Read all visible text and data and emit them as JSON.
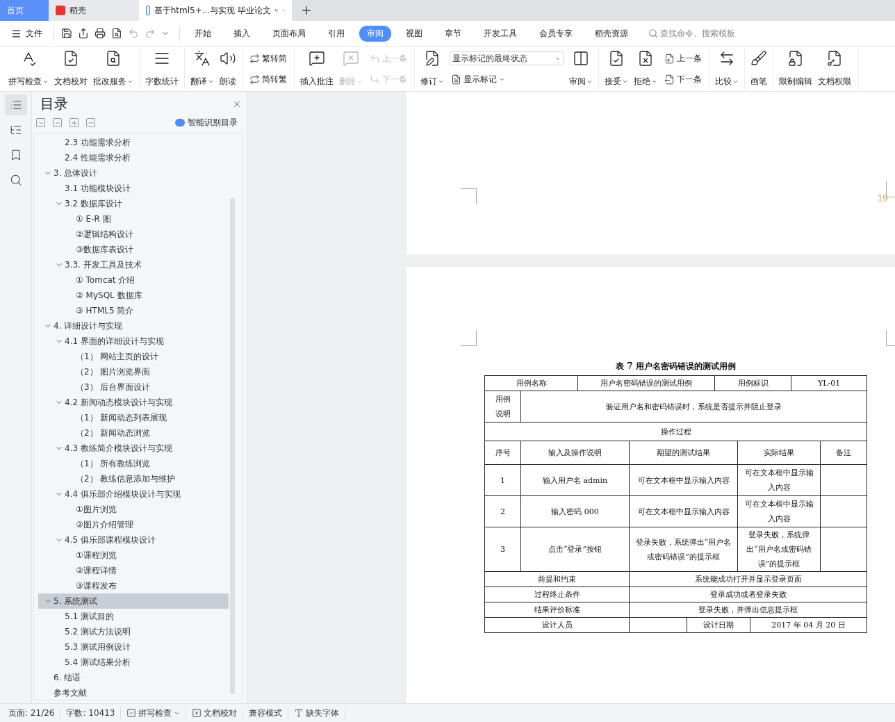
{
  "tabs": [
    {
      "kind": "home",
      "label": "首页",
      "selected": false
    },
    {
      "kind": "app",
      "label": "稻壳",
      "selected": false
    },
    {
      "kind": "doc",
      "label": "基于html5+...与实现 毕业论文",
      "selected": true
    }
  ],
  "menu": {
    "file": "文件",
    "tabs": [
      {
        "label": "开始",
        "selected": false
      },
      {
        "label": "插入",
        "selected": false
      },
      {
        "label": "页面布局",
        "selected": false
      },
      {
        "label": "引用",
        "selected": false
      },
      {
        "label": "审阅",
        "selected": true
      },
      {
        "label": "视图",
        "selected": false
      },
      {
        "label": "章节",
        "selected": false
      },
      {
        "label": "开发工具",
        "selected": false
      },
      {
        "label": "会员专享",
        "selected": false
      },
      {
        "label": "稻壳资源",
        "selected": false
      }
    ],
    "search": {
      "placeholder": "查找命令、搜索模板"
    }
  },
  "ribbon": [
    {
      "items": [
        {
          "kind": "big",
          "label": "拼写检查",
          "dropdown": true,
          "disabled": false
        },
        {
          "kind": "big",
          "label": "文档校对",
          "dropdown": false,
          "disabled": false
        },
        {
          "kind": "big",
          "label": "批改服务",
          "dropdown": true,
          "disabled": false
        }
      ]
    },
    {
      "items": [
        {
          "kind": "big",
          "label": "字数统计",
          "dropdown": false,
          "disabled": false
        }
      ]
    },
    {
      "items": [
        {
          "kind": "big",
          "label": "翻译",
          "dropdown": true,
          "disabled": false
        },
        {
          "kind": "big",
          "label": "朗读",
          "dropdown": false,
          "disabled": false
        }
      ]
    },
    {
      "items": [
        {
          "kind": "pair",
          "rows": [
            {
              "label": "繁转简",
              "disabled": false
            },
            {
              "label": "简转繁",
              "disabled": false
            }
          ]
        }
      ]
    },
    {
      "items": [
        {
          "kind": "big",
          "label": "插入批注",
          "dropdown": false,
          "disabled": false
        },
        {
          "kind": "big",
          "label": "删除",
          "dropdown": true,
          "disabled": true
        },
        {
          "kind": "pair",
          "rows": [
            {
              "label": "上一条",
              "disabled": true
            },
            {
              "label": "下一条",
              "disabled": true
            }
          ]
        }
      ]
    },
    {
      "items": [
        {
          "kind": "big",
          "label": "修订",
          "dropdown": true,
          "disabled": false
        },
        {
          "kind": "select",
          "value": "显示标记的最终状态",
          "row": {
            "label": "显示标记",
            "dropdown": true
          }
        },
        {
          "kind": "big",
          "label": "审阅",
          "dropdown": true,
          "disabled": false
        }
      ]
    },
    {
      "items": [
        {
          "kind": "big",
          "label": "接受",
          "dropdown": true,
          "disabled": false
        },
        {
          "kind": "big",
          "label": "拒绝",
          "dropdown": true,
          "disabled": false
        },
        {
          "kind": "pair",
          "rows": [
            {
              "label": "上一条",
              "disabled": false
            },
            {
              "label": "下一条",
              "disabled": false
            }
          ]
        }
      ]
    },
    {
      "items": [
        {
          "kind": "big",
          "label": "比较",
          "dropdown": true,
          "disabled": false
        }
      ]
    },
    {
      "items": [
        {
          "kind": "big",
          "label": "画笔",
          "dropdown": false,
          "disabled": false
        }
      ]
    },
    {
      "items": [
        {
          "kind": "big",
          "label": "限制编辑",
          "dropdown": false,
          "disabled": false
        },
        {
          "kind": "big",
          "label": "文档权限",
          "dropdown": false,
          "disabled": false
        }
      ]
    }
  ],
  "sidebar": {
    "title": "目录",
    "smart_button": "智能识别目录",
    "toc": {
      "scrolled_section_items": [
        {
          "label": "2.3 功能需求分析",
          "selected": false
        },
        {
          "label": "2.4 性能需求分析",
          "selected": false
        }
      ],
      "items": [
        {
          "label": "3.  总体设计",
          "selected": false,
          "expanded": true,
          "children": [
            {
              "label": "3.1 功能模块设计",
              "selected": false
            },
            {
              "label": "3.2 数据库设计",
              "selected": false,
              "expanded": true,
              "children": [
                {
                  "label": "① E-R 图",
                  "selected": false
                },
                {
                  "label": "②逻辑结构设计",
                  "selected": false
                },
                {
                  "label": "③数据库表设计",
                  "selected": false
                }
              ]
            },
            {
              "label": "3.3.  开发工具及技术",
              "selected": false,
              "expanded": true,
              "children": [
                {
                  "label": "① Tomcat 介绍",
                  "selected": false
                },
                {
                  "label": "② MySQL 数据库",
                  "selected": false
                },
                {
                  "label": "③ HTML5 简介",
                  "selected": false
                }
              ]
            }
          ]
        },
        {
          "label": "4.  详细设计与实现",
          "selected": false,
          "expanded": true,
          "children": [
            {
              "label": "4.1 界面的详细设计与实现",
              "selected": false,
              "expanded": true,
              "children": [
                {
                  "label": "（1） 网站主页的设计",
                  "selected": false
                },
                {
                  "label": "（2） 图片浏览界面",
                  "selected": false
                },
                {
                  "label": "（3） 后台界面设计",
                  "selected": false
                }
              ]
            },
            {
              "label": "4.2 新闻动态模块设计与实现",
              "selected": false,
              "expanded": true,
              "children": [
                {
                  "label": "（1） 新闻动态列表展现",
                  "selected": false
                },
                {
                  "label": "（2） 新闻动态浏览",
                  "selected": false
                }
              ]
            },
            {
              "label": "4.3 教练简介模块设计与实现",
              "selected": false,
              "expanded": true,
              "children": [
                {
                  "label": "（1） 所有教练浏览",
                  "selected": false
                },
                {
                  "label": "（2） 教练信息添加与维护",
                  "selected": false
                }
              ]
            },
            {
              "label": "4.4 俱乐部介绍模块设计与实现",
              "selected": false,
              "expanded": true,
              "children": [
                {
                  "label": "①图片浏览",
                  "selected": false
                },
                {
                  "label": "②图片介绍管理",
                  "selected": false
                }
              ]
            },
            {
              "label": "4.5 俱乐部课程模块设计",
              "selected": false,
              "expanded": true,
              "children": [
                {
                  "label": "①课程浏览",
                  "selected": false
                },
                {
                  "label": "②课程详情",
                  "selected": false
                },
                {
                  "label": "③课程发布",
                  "selected": false
                }
              ]
            }
          ]
        },
        {
          "label": "5.  系统测试",
          "selected": true,
          "expanded": true,
          "children": [
            {
              "label": "5.1 测试目的",
              "selected": false
            },
            {
              "label": "5.2 测试方法说明",
              "selected": false
            },
            {
              "label": "5.3 测试用例设计",
              "selected": false
            },
            {
              "label": "5.4 测试结果分析",
              "selected": false
            }
          ]
        },
        {
          "label": "6.  结语",
          "selected": false
        },
        {
          "label": "参考文献",
          "selected": false
        }
      ]
    }
  },
  "document": {
    "page_number": "19",
    "table": {
      "caption": "表 7  用户名密码错误的测试用例",
      "rows": [
        {
          "kind": "info",
          "cells": [
            {
              "text": "用例名称",
              "colspan": 2
            },
            {
              "text": "用户名密码错误的测试用例",
              "colspan": 3
            },
            {
              "text": "用例标识",
              "colspan": 3
            },
            {
              "text": "YL-01",
              "colspan": 2
            }
          ]
        },
        {
          "kind": "description",
          "cells": [
            {
              "text": "用例说明"
            },
            {
              "text": "验证用户名和密码错误时，系统是否提示并阻止登录",
              "colspan": 9
            }
          ]
        },
        {
          "kind": "section",
          "cells": [
            {
              "text": "操作过程",
              "colspan": 10
            }
          ]
        },
        {
          "kind": "columns",
          "cells": [
            {
              "text": "序号"
            },
            {
              "text": "输入及操作说明",
              "colspan": 2
            },
            {
              "text": "期望的测试结果",
              "colspan": 3
            },
            {
              "text": "实际结果",
              "colspan": 3
            },
            {
              "text": "备注"
            }
          ]
        },
        {
          "kind": "step",
          "cells": [
            {
              "text": "1"
            },
            {
              "text": "输入用户名 admin",
              "colspan": 2
            },
            {
              "text": "可在文本框中显示输入内容",
              "colspan": 3
            },
            {
              "text": "可在文本框中显示输入内容",
              "colspan": 3
            },
            {}
          ]
        },
        {
          "kind": "step",
          "cells": [
            {
              "text": "2"
            },
            {
              "text": "输入密码 000",
              "colspan": 2
            },
            {
              "text": "可在文本框中显示输入内容",
              "colspan": 3
            },
            {
              "text": "可在文本框中显示输入内容",
              "colspan": 3
            },
            {}
          ]
        },
        {
          "kind": "step",
          "cells": [
            {
              "text": "3"
            },
            {
              "text": "点击“登录”按钮",
              "colspan": 2
            },
            {
              "text": "登录失败，系统弹出“用户名或密码错误”的提示框",
              "colspan": 3
            },
            {
              "text": "登录失败，系统弹出“用户名或密码错误”的提示框",
              "colspan": 3
            },
            {}
          ]
        },
        {
          "kind": "footer",
          "cells": [
            {
              "text": "前提和约束",
              "colspan": 3
            },
            {
              "text": "系统能成功打开并显示登录页面",
              "colspan": 7
            }
          ]
        },
        {
          "kind": "footer",
          "cells": [
            {
              "text": "过程终止条件",
              "colspan": 3
            },
            {
              "text": "登录成功或者登录失败",
              "colspan": 7
            }
          ]
        },
        {
          "kind": "footer",
          "cells": [
            {
              "text": "结果评价标准",
              "colspan": 3
            },
            {
              "text": "登录失败，并弹出信息提示框",
              "colspan": 7
            }
          ]
        },
        {
          "kind": "signature",
          "cells": [
            {
              "text": "设计人员",
              "colspan": 3
            },
            {},
            {
              "text": "设计日期",
              "colspan": 3
            },
            {
              "text": "2017 年 04 月 20 日",
              "colspan": 3
            }
          ]
        }
      ]
    }
  },
  "status_bar": [
    {
      "kind": "text",
      "label": "页面: 21/26",
      "dropdown": false
    },
    {
      "kind": "text",
      "label": "字数: 10413",
      "dropdown": false
    },
    {
      "kind": "check",
      "label": "拼写检查",
      "dropdown": true
    },
    {
      "kind": "proof",
      "label": "文档校对",
      "dropdown": false
    },
    {
      "kind": "text",
      "label": "兼容模式",
      "dropdown": false
    },
    {
      "kind": "font",
      "label": "缺失字体",
      "dropdown": false
    }
  ]
}
